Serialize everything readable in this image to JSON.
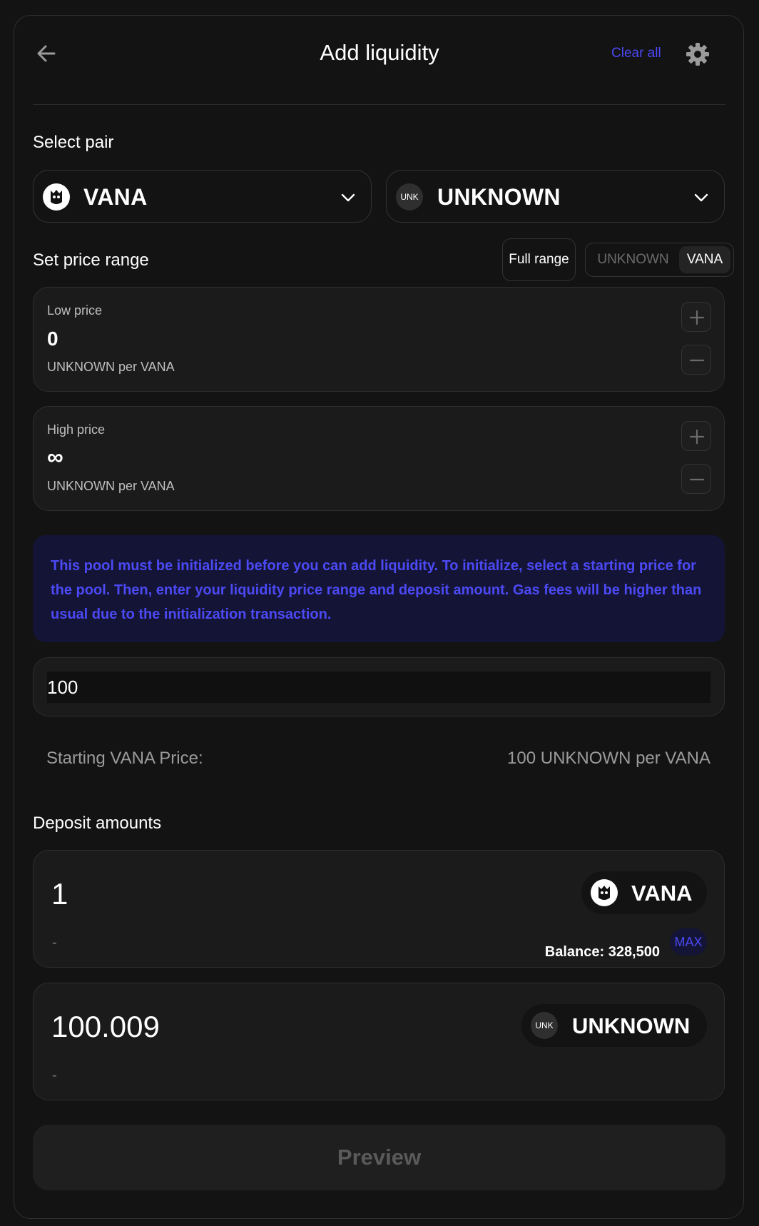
{
  "header": {
    "title": "Add liquidity",
    "clear_all_label": "Clear all"
  },
  "pair": {
    "label": "Select pair",
    "token_a": {
      "symbol": "VANA",
      "icon": "vana-logo-icon"
    },
    "token_b": {
      "symbol": "UNKNOWN",
      "icon_text": "UNK"
    }
  },
  "range": {
    "label": "Set price range",
    "full_range_label": "Full range",
    "denom_options": [
      "UNKNOWN",
      "VANA"
    ],
    "denom_selected": "VANA",
    "low": {
      "label": "Low price",
      "value": "0",
      "unit": "UNKNOWN per VANA"
    },
    "high": {
      "label": "High price",
      "value": "∞",
      "unit": "UNKNOWN per VANA"
    }
  },
  "notice": {
    "text": "This pool must be initialized before you can add liquidity. To initialize, select a starting price for the pool. Then, enter your liquidity price range and deposit amount. Gas fees will be higher than usual due to the initialization transaction."
  },
  "starting_price": {
    "input_value": "100",
    "label": "Starting VANA Price:",
    "value": "100 UNKNOWN per VANA"
  },
  "deposit": {
    "label": "Deposit amounts",
    "token_a": {
      "amount": "1",
      "usd": "-",
      "symbol": "VANA",
      "balance": "Balance: 328,500",
      "max_label": "MAX"
    },
    "token_b": {
      "amount": "100.009",
      "usd": "-",
      "symbol": "UNKNOWN",
      "icon_text": "UNK"
    }
  },
  "preview_label": "Preview",
  "colors": {
    "background": "#131313",
    "panel": "#1b1b1b",
    "accent": "#4c49f5",
    "notice_bg": "#141536",
    "muted_text": "#9b9b9b"
  }
}
